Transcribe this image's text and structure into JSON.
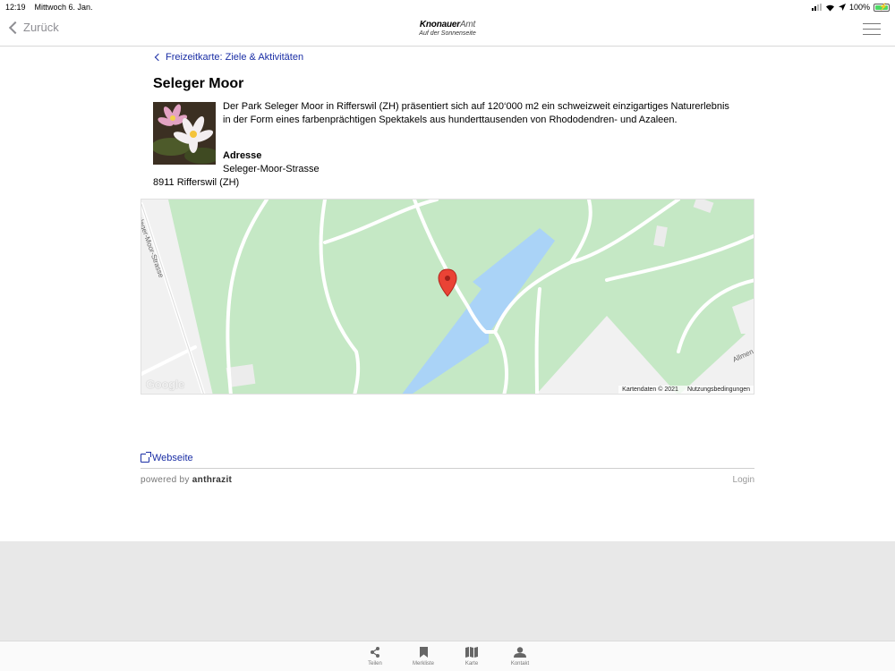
{
  "status_bar": {
    "time": "12:19",
    "date": "Mittwoch 6. Jan.",
    "battery": "100%"
  },
  "nav": {
    "back_label": "Zurück",
    "brand_bold": "Knonauer",
    "brand_light": "Amt",
    "brand_tagline": "Auf der Sonnenseite"
  },
  "breadcrumb": "Freizeitkarte: Ziele & Aktivitäten",
  "title": "Seleger Moor",
  "description": "Der Park Seleger Moor in Rifferswil (ZH) präsentiert sich auf 120‘000 m2 ein schweizweit einzigartiges Naturerlebnis in der Form eines farbenprächtigen Spektakels aus hunderttausenden von Rhododendren- und Azaleen.",
  "address": {
    "label": "Adresse",
    "street": "Seleger-Moor-Strasse",
    "city": "8911 Rifferswil (ZH)"
  },
  "map": {
    "street_label_1": "Seleger-Moor-Strasse",
    "street_label_2": "Allmen",
    "google": "Google",
    "attribution": "Kartendaten © 2021",
    "terms": "Nutzungsbedingungen",
    "park_color": "#c5e8c5",
    "water_color": "#aad3f7",
    "marker_color": "#ea4335"
  },
  "website_link": "Webseite",
  "footer": {
    "powered_prefix": "powered by",
    "powered_brand": "anthrazit",
    "login": "Login"
  },
  "tabbar": [
    {
      "label": "Teilen",
      "icon": "share-icon"
    },
    {
      "label": "Merkliste",
      "icon": "bookmark-icon"
    },
    {
      "label": "Karte",
      "icon": "map-icon"
    },
    {
      "label": "Kontakt",
      "icon": "person-icon"
    }
  ]
}
